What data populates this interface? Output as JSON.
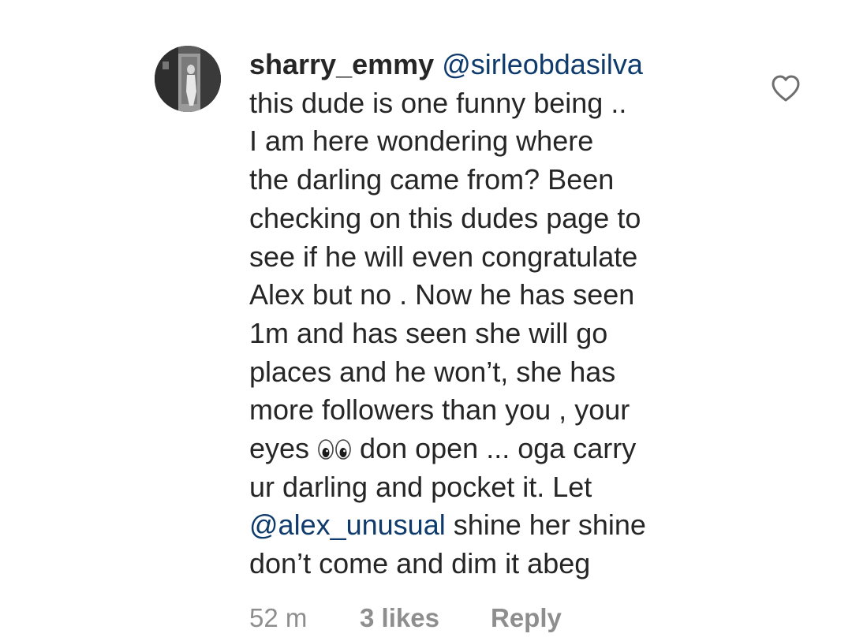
{
  "comment": {
    "username": "sharry_emmy",
    "reply_to": "@sirleobdasilva",
    "lines": [
      "this dude is one funny being ..",
      "I am here wondering where",
      "the darling came from? Been",
      "checking on this dudes page to",
      "see if he will even congratulate",
      "Alex but no . Now he has seen",
      "1m and has seen she will go",
      "places and he won’t, she has",
      "more followers than you , your"
    ],
    "eyes_line": {
      "before": "eyes ",
      "emoji_icon": "eyes-emoji-icon",
      "after": " don open ... oga carry"
    },
    "line_after_eyes": "ur darling and pocket it. Let",
    "mention_line": {
      "mention": "@alex_unusual",
      "after": " shine her shine"
    },
    "last_line": "don’t come and dim it abeg",
    "time_ago": "52 m",
    "likes": "3 likes",
    "reply_label": "Reply",
    "like_icon": "heart-outline-icon",
    "avatar_icon": "profile-photo-avatar"
  },
  "colors": {
    "text": "#262626",
    "mention": "#0e3a6c",
    "meta": "#8e8e8e",
    "background": "#ffffff"
  }
}
